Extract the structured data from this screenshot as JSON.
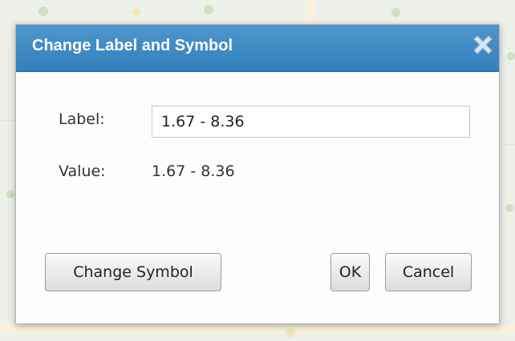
{
  "dialog": {
    "title": "Change Label and Symbol",
    "label_caption": "Label:",
    "label_value": "1.67 - 8.36",
    "value_caption": "Value:",
    "value_text": "1.67 - 8.36",
    "change_symbol_label": "Change Symbol",
    "ok_label": "OK",
    "cancel_label": "Cancel"
  },
  "colors": {
    "titlebar": "#3f8bc6",
    "title_text": "#ffffff"
  },
  "icons": {
    "close": "close-icon"
  }
}
